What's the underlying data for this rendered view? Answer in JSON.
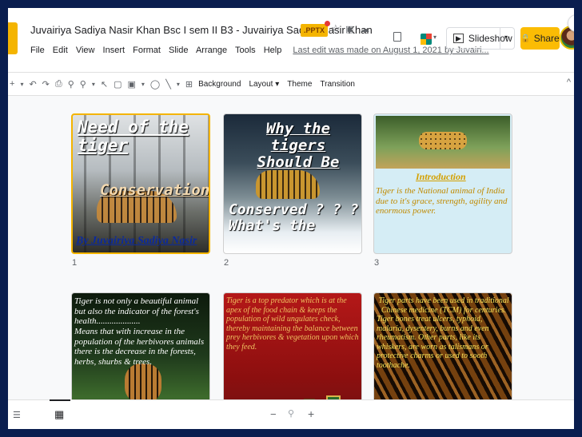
{
  "header": {
    "title": "Juvairiya Sadiya Nasir Khan Bsc I sem II B3 - Juvairiya Sadiya Nasir Khan",
    "badge": ".PPTX",
    "menu": [
      "File",
      "Edit",
      "View",
      "Insert",
      "Format",
      "Slide",
      "Arrange",
      "Tools",
      "Help"
    ],
    "last_edit": "Last edit was made on August 1, 2021 by Juvairi...",
    "slideshow_label": "Slideshow",
    "share_label": "Share"
  },
  "toolbar": {
    "items": [
      "Background",
      "Layout",
      "Theme",
      "Transition"
    ]
  },
  "slides": [
    {
      "number": "1",
      "title_lines": [
        "Need of the",
        "tiger"
      ],
      "subtitle": "Conservation",
      "author": "By Juvairiya Sadiya Nasir"
    },
    {
      "number": "2",
      "title_lines": [
        "Why the tigers",
        "Should Be"
      ],
      "bottom_lines": [
        "Conserved ? ? ?",
        "What's the"
      ]
    },
    {
      "number": "3",
      "heading": "Introduction",
      "body": "Tiger is the National animal of India due to it's grace, strength, agility and enormous power."
    },
    {
      "number": "",
      "body_lines": [
        "Tiger is not only a beautiful animal but also the indicator of the forest's health....................",
        "Means that with increase in the population of the herbivores animals there is the decrease in the forests, herbs, shurbs & trees."
      ]
    },
    {
      "number": "",
      "body": "Tiger is a top predator which is at the apex of the food chain & keeps the population of wild ungulates check, thereby maintaining the balance between prey herbivores & vegetation upon which they feed."
    },
    {
      "number": "",
      "body_lines": [
        "Tiger parts have been used in traditional Chinese medicine (TCM) for centuries.",
        "Tiger bones treat ulcers, typhoid, malaria, dysentery, burns and even rheumatism. Other parts, like its whiskers, are worn as talismans or protective charms or used to sooth toothache."
      ]
    }
  ],
  "colors": {
    "frame": "#0a1e4f",
    "accent": "#fbbc04",
    "selected_border": "#f4b400"
  }
}
